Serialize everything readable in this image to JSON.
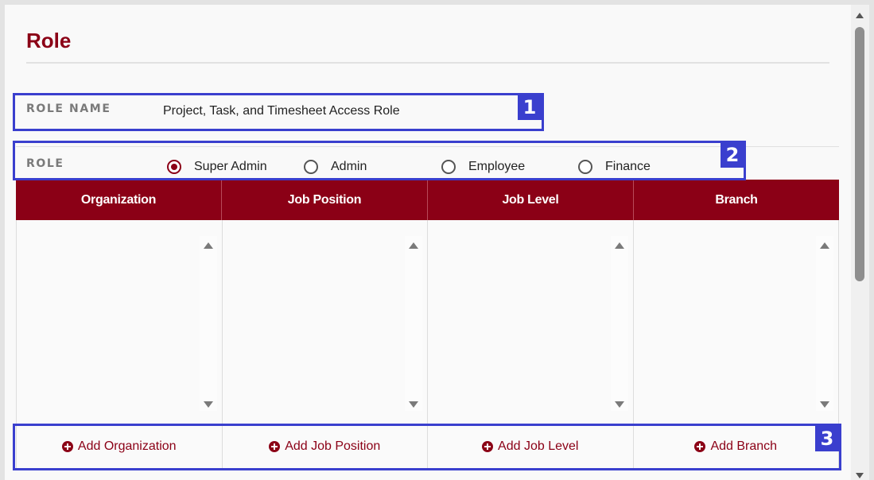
{
  "page": {
    "title": "Role"
  },
  "role_name": {
    "label": "ROLE NAME",
    "value": "Project, Task, and Timesheet Access Role"
  },
  "role": {
    "label": "ROLE",
    "options": [
      {
        "label": "Super Admin",
        "checked": true
      },
      {
        "label": "Admin",
        "checked": false
      },
      {
        "label": "Employee",
        "checked": false
      },
      {
        "label": "Finance",
        "checked": false
      }
    ]
  },
  "table": {
    "headers": [
      "Organization",
      "Job Position",
      "Job Level",
      "Branch"
    ],
    "add_buttons": [
      "Add Organization",
      "Add Job Position",
      "Add Job Level",
      "Add Branch"
    ]
  },
  "callouts": [
    "1",
    "2",
    "3"
  ],
  "colors": {
    "accent": "#8b0016",
    "callout": "#3a3fce"
  }
}
